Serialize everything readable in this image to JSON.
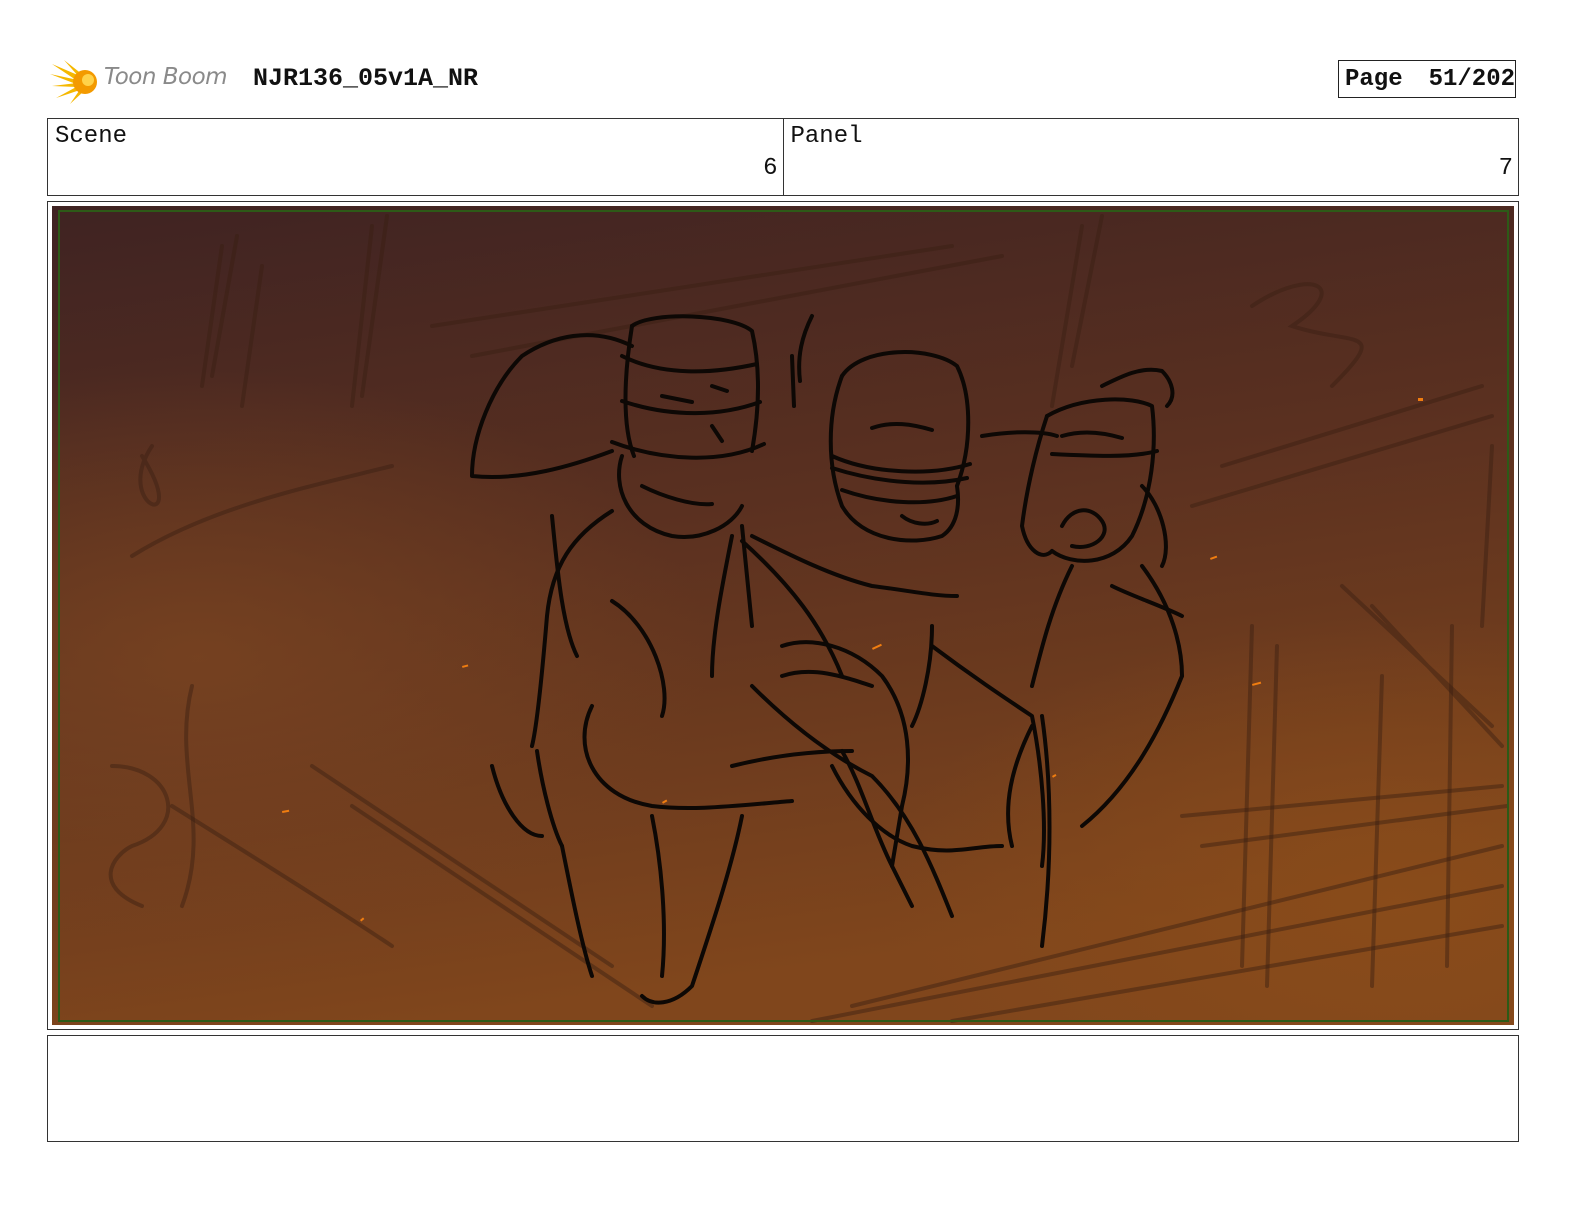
{
  "header": {
    "logo_text": "Toon Boom",
    "logo_icon": "starburst-icon",
    "document_title": "NJR136_05v1A_NR",
    "page_label": "Page",
    "page_number": "51/202"
  },
  "info": {
    "scene_label": "Scene",
    "scene_value": "6",
    "panel_label": "Panel",
    "panel_value": "7"
  },
  "panel": {
    "content": "storyboard-sketch",
    "colors": {
      "bg_top": "#3f2322",
      "bg_bottom": "#80461c",
      "safe_frame": "#2d5a17",
      "ember": "#f07d10",
      "ink": "#0d0805"
    }
  },
  "notes": {
    "text": ""
  }
}
